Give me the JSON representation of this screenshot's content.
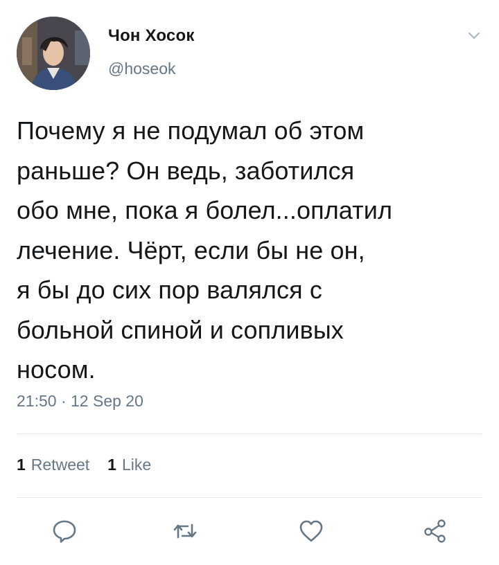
{
  "tweet": {
    "display_name": "Чон Хосок",
    "handle": "@hoseok",
    "text": "Почему я не подумал об этом\nраньше? Он ведь, заботился\nобо мне, пока я болел...оплатил\nлечение. Чёрт, если бы не он,\nя бы до сих пор валялся с\nбольной спиной и сопливых\nносом.",
    "time": "21:50",
    "separator": "·",
    "date": "12 Sep 20",
    "retweet_count": "1",
    "retweet_label": "Retweet",
    "like_count": "1",
    "like_label": "Like"
  },
  "icons": {
    "menu": "chevron-down-icon",
    "reply": "reply-icon",
    "retweet": "retweet-icon",
    "like": "heart-icon",
    "share": "share-icon"
  },
  "colors": {
    "text": "#14171a",
    "secondary": "#657786",
    "divider": "#e1e8ed",
    "icon": "#657786"
  }
}
